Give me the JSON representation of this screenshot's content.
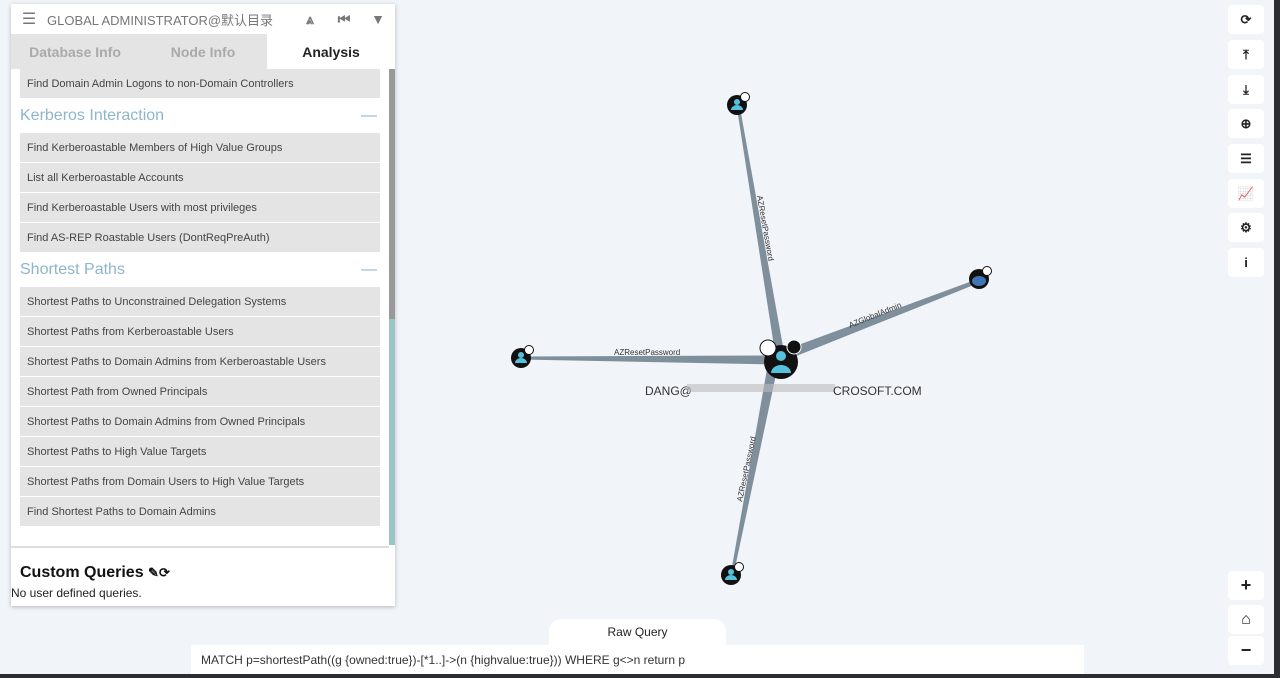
{
  "header": {
    "title": "GLOBAL ADMINISTRATOR@默认目录",
    "menu_icon": "hamburger-icon",
    "icons": [
      "pathfinding-icon",
      "back-icon",
      "filter-icon"
    ]
  },
  "tabs": [
    {
      "label": "Database Info"
    },
    {
      "label": "Node Info"
    },
    {
      "label": "Analysis",
      "active": true
    }
  ],
  "queries": {
    "top_item": "Find Domain Admin Logons to non-Domain Controllers",
    "sections": [
      {
        "title": "Kerberos Interaction",
        "toggle": "—",
        "items": [
          "Find Kerberoastable Members of High Value Groups",
          "List all Kerberoastable Accounts",
          "Find Kerberoastable Users with most privileges",
          "Find AS-REP Roastable Users (DontReqPreAuth)"
        ]
      },
      {
        "title": "Shortest Paths",
        "toggle": "—",
        "items": [
          "Shortest Paths to Unconstrained Delegation Systems",
          "Shortest Paths from Kerberoastable Users",
          "Shortest Paths to Domain Admins from Kerberoastable Users",
          "Shortest Path from Owned Principals",
          "Shortest Paths to Domain Admins from Owned Principals",
          "Shortest Paths to High Value Targets",
          "Shortest Paths from Domain Users to High Value Targets",
          "Find Shortest Paths to Domain Admins"
        ]
      }
    ]
  },
  "custom": {
    "title": "Custom Queries",
    "empty": "No user defined queries."
  },
  "graph": {
    "center_label_start": "DANG@",
    "center_label_end": "CROSOFT.COM",
    "edges": [
      {
        "label": "AZResetPassword"
      },
      {
        "label": "AZGlobalAdmin"
      },
      {
        "label": "AZResetPassword"
      },
      {
        "label": "AZResetPassword"
      }
    ]
  },
  "toolbar": [
    "refresh-icon",
    "export-icon",
    "import-icon",
    "upload-icon",
    "query-list-icon",
    "chart-icon",
    "settings-icon",
    "info-icon"
  ],
  "zoom": {
    "plus": "+",
    "home": "⌂",
    "minus": "−"
  },
  "raw_query": {
    "label": "Raw Query",
    "value": "MATCH p=shortestPath((g {owned:true})-[*1..]->(n {highvalue:true})) WHERE  g<>n return p"
  },
  "colors": {
    "user": "#55c1dd",
    "tenant": "#3f76b6",
    "edge": "#7f8f9b",
    "section": "#8db6cc"
  }
}
